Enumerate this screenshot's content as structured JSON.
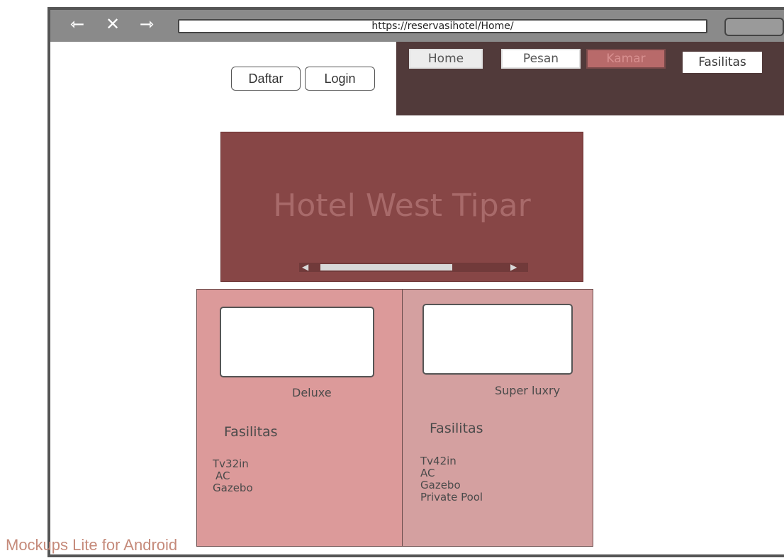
{
  "browser": {
    "url": "https://reservasihotel/Home/",
    "nav_icons": [
      "back-arrow-icon",
      "close-icon",
      "forward-arrow-icon"
    ]
  },
  "auth": {
    "daftar_label": "Daftar",
    "login_label": "Login"
  },
  "nav": {
    "items": [
      {
        "label": "Home"
      },
      {
        "label": "Pesan"
      },
      {
        "label": "Kamar",
        "active": true
      },
      {
        "label": "Fasilitas"
      }
    ]
  },
  "banner": {
    "title": "Hotel West Tipar"
  },
  "rooms": [
    {
      "name": "Deluxe",
      "facilities_heading": "Fasilitas",
      "facilities": [
        "Tv32in",
        "AC",
        "Gazebo"
      ]
    },
    {
      "name": "Super luxry",
      "facilities_heading": "Fasilitas",
      "facilities": [
        "Tv42in",
        "AC",
        "Gazebo",
        "Private Pool"
      ]
    }
  ],
  "watermark": "Mockups Lite for Android",
  "colors": {
    "nav_bg": "#513a3a",
    "banner_bg": "#874646",
    "active_nav": "#b86a6a",
    "card_left": "#dc9a9a",
    "card_right": "#d4a0a0"
  }
}
